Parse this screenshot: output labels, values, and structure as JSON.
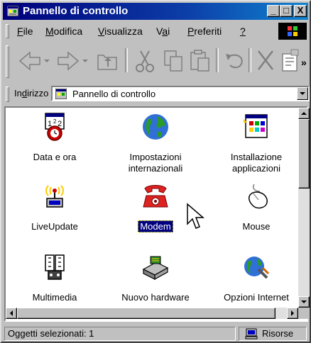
{
  "window": {
    "title": "Pannello di controllo",
    "minimize_glyph": "_",
    "maximize_glyph": "□",
    "close_glyph": "X"
  },
  "menu": [
    {
      "label": "File",
      "accel": "F",
      "rest": "ile"
    },
    {
      "label": "Modifica",
      "accel": "M",
      "rest": "odifica"
    },
    {
      "label": "Visualizza",
      "accel": "V",
      "rest": "isualizza"
    },
    {
      "label": "Vai",
      "pre": "V",
      "accel": "a",
      "rest": "i"
    },
    {
      "label": "Preferiti",
      "accel": "P",
      "rest": "referiti"
    },
    {
      "label": "?",
      "accel": "?",
      "rest": ""
    }
  ],
  "toolbar": {
    "icons": [
      "back-arrow-icon",
      "forward-arrow-icon",
      "up-folder-icon",
      "cut-icon",
      "copy-icon",
      "paste-icon",
      "undo-icon",
      "delete-icon",
      "properties-icon"
    ],
    "overflow": "»"
  },
  "address": {
    "label_pre": "In",
    "label_accel": "d",
    "label_rest": "irizzo",
    "value": "Pannello di controllo"
  },
  "items": [
    {
      "label": "Data e ora",
      "icon": "calendar-clock-icon"
    },
    {
      "label": "Impostazioni internazionali",
      "icon": "globe-icon"
    },
    {
      "label": "Installazione applicazioni",
      "icon": "install-apps-icon"
    },
    {
      "label": "LiveUpdate",
      "icon": "liveupdate-antenna-icon"
    },
    {
      "label": "Modem",
      "icon": "modem-phone-icon",
      "selected": true
    },
    {
      "label": "Mouse",
      "icon": "mouse-icon"
    },
    {
      "label": "Multimedia",
      "icon": "multimedia-film-icon"
    },
    {
      "label": "Nuovo hardware",
      "icon": "new-hardware-icon"
    },
    {
      "label": "Opzioni Internet",
      "icon": "internet-options-globe-icon"
    }
  ],
  "status": {
    "selected": "Oggetti selezionati: 1",
    "zone": "Risorse"
  },
  "colors": {
    "title_gradient_start": "#00007b",
    "title_gradient_end": "#1084d0",
    "selection": "#000080",
    "face": "#c0c0c0"
  }
}
